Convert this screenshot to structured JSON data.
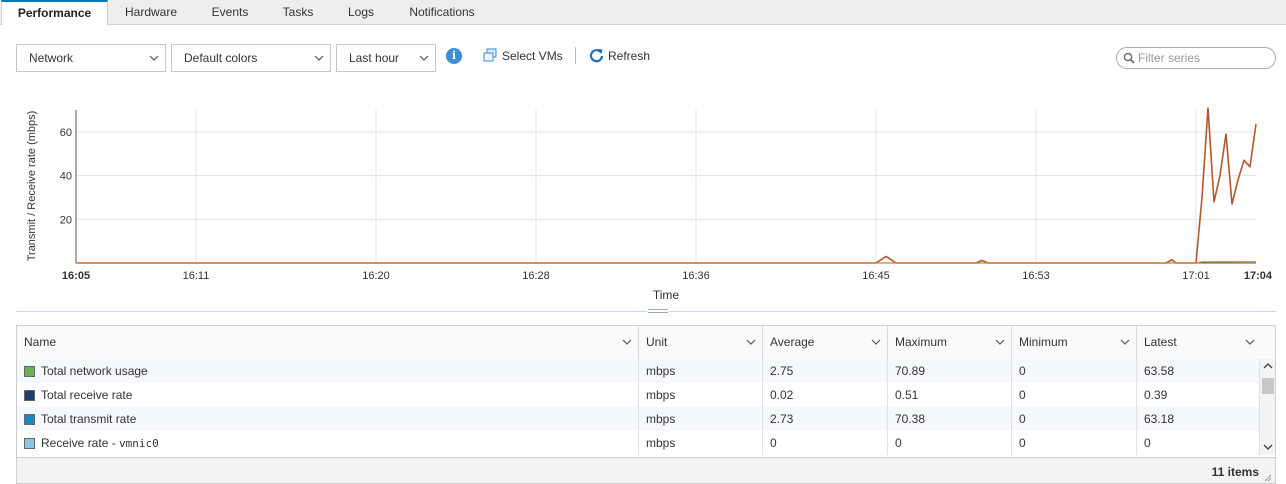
{
  "tabs": [
    {
      "label": "Performance",
      "active": true
    },
    {
      "label": "Hardware"
    },
    {
      "label": "Events"
    },
    {
      "label": "Tasks"
    },
    {
      "label": "Logs"
    },
    {
      "label": "Notifications"
    }
  ],
  "toolbar": {
    "metric_select": "Network",
    "color_select": "Default colors",
    "range_select": "Last hour",
    "info_icon": "i",
    "select_vms_label": "Select VMs",
    "refresh_label": "Refresh",
    "filter_placeholder": "Filter series"
  },
  "colors": {
    "accent": "#0079b8",
    "line_primary": "#b5572a"
  },
  "chart_data": {
    "type": "line",
    "ylabel": "Transmit / Receive rate (mbps)",
    "xlabel": "Time",
    "ylim": [
      0,
      70
    ],
    "yticks": [
      20,
      40,
      60
    ],
    "xticks": [
      "16:05",
      "16:11",
      "16:20",
      "16:28",
      "16:36",
      "16:45",
      "16:53",
      "17:01",
      "17:04"
    ],
    "bold_xticks": [
      "16:05",
      "17:04"
    ],
    "grid": true,
    "series": [
      {
        "name": "Total network usage",
        "color": "#b5572a",
        "x": [
          "16:05",
          "16:45",
          "16:45.5",
          "16:46",
          "16:50",
          "16:50.3",
          "16:50.6",
          "16:59.5",
          "16:59.8",
          "17:00",
          "17:01",
          "17:01.3",
          "17:01.6",
          "17:01.9",
          "17:02.2",
          "17:02.5",
          "17:02.8",
          "17:03.1",
          "17:03.4",
          "17:03.7",
          "17:04"
        ],
        "values": [
          0,
          0,
          3,
          0,
          0,
          1.2,
          0,
          0,
          1.5,
          0,
          0,
          30,
          70.89,
          28,
          40,
          59,
          27,
          38,
          47,
          44,
          63.58
        ]
      },
      {
        "name": "Total transmit rate",
        "color": "#c8853a",
        "x": [
          "16:05",
          "17:01",
          "17:01.3",
          "17:04"
        ],
        "values": [
          0,
          0,
          0.5,
          0.6
        ]
      }
    ]
  },
  "table": {
    "columns": [
      "Name",
      "Unit",
      "Average",
      "Maximum",
      "Minimum",
      "Latest"
    ],
    "rows": [
      {
        "name": "Total network usage",
        "swatch": "#6ab04c",
        "unit": "mbps",
        "average": "2.75",
        "maximum": "70.89",
        "minimum": "0",
        "latest": "63.58"
      },
      {
        "name": "Total receive rate",
        "swatch": "#1f3c6e",
        "unit": "mbps",
        "average": "0.02",
        "maximum": "0.51",
        "minimum": "0",
        "latest": "0.39"
      },
      {
        "name": "Total transmit rate",
        "swatch": "#1b84c7",
        "unit": "mbps",
        "average": "2.73",
        "maximum": "70.38",
        "minimum": "0",
        "latest": "63.18"
      },
      {
        "name": "Receive rate - ",
        "name_mono": "vmnic0",
        "swatch": "#8fc4e0",
        "unit": "mbps",
        "average": "0",
        "maximum": "0",
        "minimum": "0",
        "latest": "0"
      }
    ],
    "footer_count": "11 items"
  }
}
